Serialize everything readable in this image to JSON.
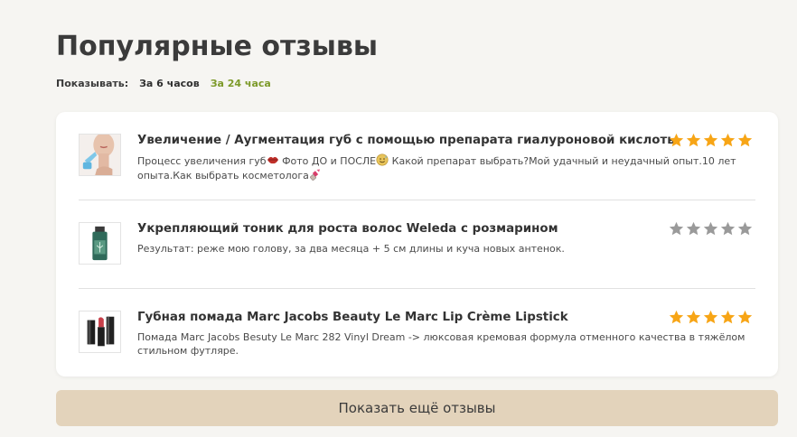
{
  "page": {
    "title": "Популярные отзывы"
  },
  "filters": {
    "label": "Показывать:",
    "options": [
      {
        "label": "За 6 часов",
        "active": false
      },
      {
        "label": "За 24 часа",
        "active": true
      }
    ]
  },
  "reviews": [
    {
      "title": "Увеличение / Аугментация губ с помощью препарата гиалуроновой кислоты",
      "text_parts": [
        "Процесс увеличения губ",
        " Фото ДО и ПОСЛЕ",
        " Какой препарат выбрать?Мой удачный и неудачный опыт.10 лет опыта.Как выбрать косметолога"
      ],
      "emojis": [
        "lips-emoji",
        "sweat-smile-emoji",
        "lipstick-emoji"
      ],
      "rating": 5,
      "image_icon": "lip-injection-photo"
    },
    {
      "title": "Укрепляющий тоник для роста волос Weleda с розмарином",
      "text": "Результат: реже мою голову, за два месяца + 5 см длины и куча новых антенок.",
      "rating": 0,
      "image_icon": "tonic-bottle-photo"
    },
    {
      "title": "Губная помада Marc Jacobs Beauty Le Marc Lip Crème Lipstick",
      "text": "Помада Marc Jacobs Besuty Le Marc 282 Vinyl Dream -> люксовая кремовая формула отменного качества в тяжёлом стильном футляре.",
      "rating": 5,
      "image_icon": "lipstick-photo"
    }
  ],
  "colors": {
    "star_filled": "#f7a516",
    "star_empty": "#9a9a9a",
    "active_filter": "#7d9a2a",
    "button_bg": "#e3d3bb"
  },
  "more_button": {
    "label": "Показать ещё отзывы"
  }
}
